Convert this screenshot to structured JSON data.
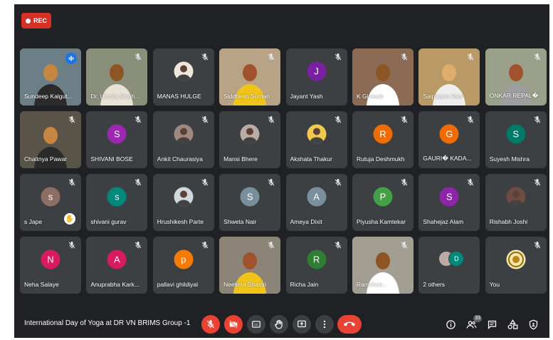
{
  "recording": {
    "label": "REC",
    "color": "#d93025"
  },
  "participants": [
    {
      "name": "Sundeep Kalgut...",
      "type": "video",
      "bg": "#6d7f86",
      "speaking": true
    },
    {
      "name": "Dr. Urmila Singh...",
      "type": "video",
      "bg": "#8a8f7a"
    },
    {
      "name": "MANAS HULGE",
      "type": "photo",
      "avatar_color": "#efe7dc"
    },
    {
      "name": "Siddhesh Soman",
      "type": "video",
      "bg": "#b9a387"
    },
    {
      "name": "Jayant Yash",
      "type": "letter",
      "letter": "J",
      "avatar_color": "#7b1fa2"
    },
    {
      "name": "K Gireesh",
      "type": "video",
      "bg": "#8c6b55"
    },
    {
      "name": "Saipawan Rao",
      "type": "video",
      "bg": "#b99a66"
    },
    {
      "name": "ONKAR REPAL�",
      "type": "video",
      "bg": "#9aa08a"
    },
    {
      "name": "Chaitnya Pawar",
      "type": "video",
      "bg": "#5a5348"
    },
    {
      "name": "SHIVANI BOSE",
      "type": "letter",
      "letter": "S",
      "avatar_color": "#9c27b0"
    },
    {
      "name": "Ankit Chaurasiya",
      "type": "photo",
      "avatar_color": "#a1887f"
    },
    {
      "name": "Mansi Bhere",
      "type": "photo",
      "avatar_color": "#bcaaa4"
    },
    {
      "name": "Akshata Thakur",
      "type": "photo",
      "avatar_color": "#f2c94c"
    },
    {
      "name": "Rutuja Deshmukh",
      "type": "letter",
      "letter": "R",
      "avatar_color": "#ef6c00"
    },
    {
      "name": "GAURI� KADA...",
      "type": "letter",
      "letter": "G",
      "avatar_color": "#ef6c00"
    },
    {
      "name": "Suyesh Mishra",
      "type": "letter",
      "letter": "S",
      "avatar_color": "#00796b"
    },
    {
      "name": "s Jape",
      "type": "letter",
      "letter": "s",
      "avatar_color": "#8d6e63",
      "hand": true
    },
    {
      "name": "shivani gurav",
      "type": "letter",
      "letter": "s",
      "avatar_color": "#00897b"
    },
    {
      "name": "Hrushikesh Parte",
      "type": "photo",
      "avatar_color": "#cfd8dc"
    },
    {
      "name": "Shweta Nair",
      "type": "letter",
      "letter": "S",
      "avatar_color": "#78909c"
    },
    {
      "name": "Ameya Dixit",
      "type": "letter",
      "letter": "A",
      "avatar_color": "#78909c"
    },
    {
      "name": "Piyusha Kamtekar",
      "type": "letter",
      "letter": "P",
      "avatar_color": "#43a047"
    },
    {
      "name": "Shahejaz Alam",
      "type": "letter",
      "letter": "S",
      "avatar_color": "#8e24aa"
    },
    {
      "name": "Rishabh Joshi",
      "type": "photo",
      "avatar_color": "#6d4c41"
    },
    {
      "name": "Neha Salaye",
      "type": "letter",
      "letter": "N",
      "avatar_color": "#d81b60"
    },
    {
      "name": "Anuprabha Kark...",
      "type": "letter",
      "letter": "A",
      "avatar_color": "#d81b60"
    },
    {
      "name": "pallavi ghildiyal",
      "type": "letter",
      "letter": "p",
      "avatar_color": "#f57c00"
    },
    {
      "name": "Neelima Shastri",
      "type": "video",
      "bg": "#8c8577"
    },
    {
      "name": "Richa Jain",
      "type": "letter",
      "letter": "R",
      "avatar_color": "#2e7d32"
    },
    {
      "name": "Ramchan...",
      "type": "video",
      "bg": "#a39e92"
    },
    {
      "name": "2 others",
      "type": "others",
      "letter": "D",
      "avatar_color": "#00897b"
    },
    {
      "name": "You",
      "type": "logo",
      "avatar_color": "#f5e6b3"
    }
  ],
  "bottom_bar": {
    "meeting_title": "International Day of Yoga at DR VN BRIMS Group -1",
    "participant_count": "33",
    "hangup_color": "#ea4335"
  }
}
